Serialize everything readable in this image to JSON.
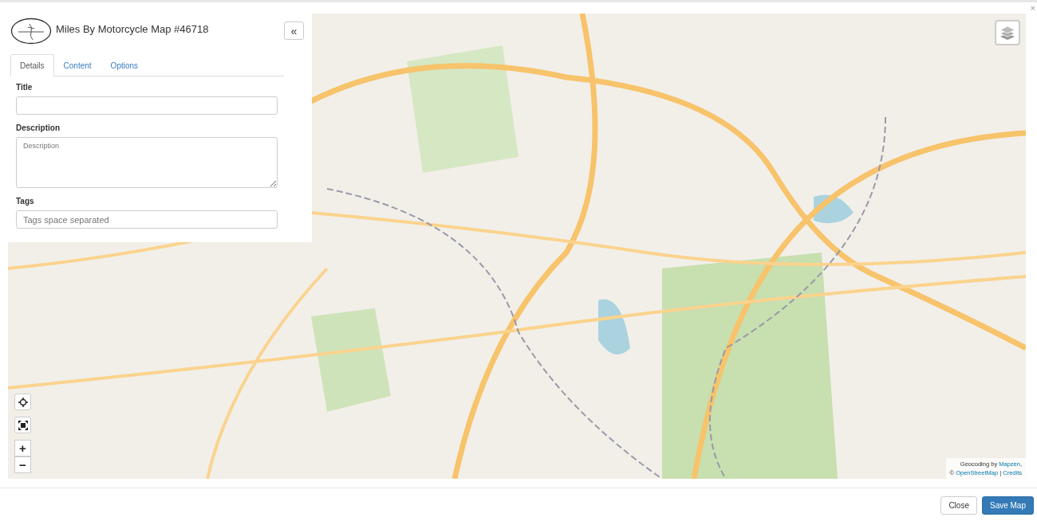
{
  "page": {
    "close_glyph": "×"
  },
  "panel": {
    "title": "Miles By Motorcycle Map #46718",
    "collapse_glyph": "«",
    "tabs": [
      {
        "label": "Details",
        "selected": true
      },
      {
        "label": "Content",
        "selected": false
      },
      {
        "label": "Options",
        "selected": false
      }
    ],
    "fields": [
      {
        "kind": "input",
        "label": "Title"
      },
      {
        "kind": "textarea",
        "label": "Description",
        "placeholder": "Description"
      },
      {
        "kind": "input",
        "label": "Tags",
        "placeholder": "Tags space separated"
      }
    ]
  },
  "map_controls": {
    "zoom_in": "+",
    "zoom_out": "−"
  },
  "attribution": [
    [
      {
        "kind": "text",
        "text": "Geocoding by "
      },
      {
        "kind": "link",
        "text": "Mapzen"
      },
      {
        "kind": "text",
        "text": ","
      }
    ],
    [
      {
        "kind": "text",
        "text": "© "
      },
      {
        "kind": "link",
        "text": "OpenStreetMap"
      },
      {
        "kind": "text",
        "text": " | "
      },
      {
        "kind": "link",
        "text": "Credits"
      }
    ]
  ],
  "buttons": [
    {
      "label": "Close",
      "kind": "default"
    },
    {
      "label": "Save Map",
      "kind": "primary"
    }
  ]
}
